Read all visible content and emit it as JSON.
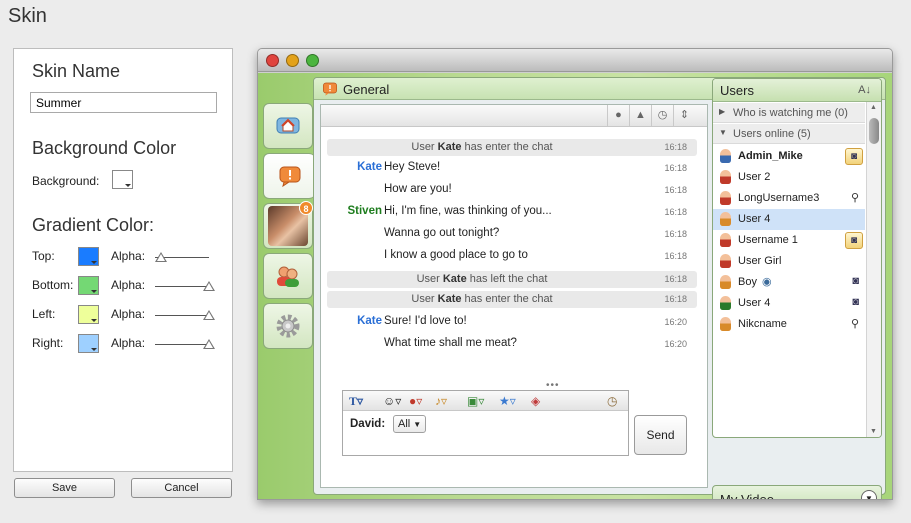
{
  "page": {
    "title": "Skin"
  },
  "skin_editor": {
    "name_label": "Skin Name",
    "name_value": "Summer",
    "background_section": "Background Color",
    "background_label": "Background:",
    "gradient_section": "Gradient Color:",
    "rows": [
      {
        "label": "Top:",
        "color": "#1a7cff",
        "alpha_label": "Alpha:",
        "alpha": 0.0
      },
      {
        "label": "Bottom:",
        "color": "#74d874",
        "alpha_label": "Alpha:",
        "alpha": 1.0
      },
      {
        "label": "Left:",
        "color": "#eeff9a",
        "alpha_label": "Alpha:",
        "alpha": 1.0
      },
      {
        "label": "Right:",
        "color": "#9ed0ff",
        "alpha_label": "Alpha:",
        "alpha": 1.0
      }
    ],
    "background_color": "#ffffff",
    "save_label": "Save",
    "cancel_label": "Cancel"
  },
  "chat": {
    "panel_title": "General",
    "messages": [
      {
        "type": "system",
        "pre": "User ",
        "name": "Kate",
        "post": " has enter the chat",
        "time": "16:18"
      },
      {
        "type": "msg",
        "sender": "Kate",
        "sender_color": "#2a6fd6",
        "text": "Hey Steve!",
        "time": "16:18"
      },
      {
        "type": "msg",
        "sender": "",
        "text": "How are you!",
        "time": "16:18"
      },
      {
        "type": "msg",
        "sender": "Stiven",
        "sender_color": "#1e7d1e",
        "text": "Hi, I'm fine, was thinking of you...",
        "time": "16:18"
      },
      {
        "type": "msg",
        "sender": "",
        "text": "Wanna go out tonight?",
        "time": "16:18"
      },
      {
        "type": "msg",
        "sender": "",
        "text": "I know a good place to go to",
        "time": "16:18"
      },
      {
        "type": "system",
        "pre": "User ",
        "name": "Kate",
        "post": " has left the chat",
        "time": "16:18"
      },
      {
        "type": "system",
        "pre": "User ",
        "name": "Kate",
        "post": " has enter the chat",
        "time": "16:18"
      },
      {
        "type": "msg",
        "sender": "Kate",
        "sender_color": "#2a6fd6",
        "text": "Sure! I'd love to!",
        "time": "16:20"
      },
      {
        "type": "msg",
        "sender": "",
        "text": "What time shall me meat?",
        "time": "16:20"
      }
    ],
    "compose_user": "David:",
    "compose_target": "All",
    "send_label": "Send",
    "grip": "•••"
  },
  "users": {
    "title": "Users",
    "sort_label": "A",
    "groups": [
      {
        "label": "Who is watching me (0)",
        "expanded": false
      },
      {
        "label": "Users online (5)",
        "expanded": true
      }
    ],
    "list": [
      {
        "name": "Admin_Mike",
        "bold": true,
        "badge": "cam-box"
      },
      {
        "name": "User 2",
        "badge": ""
      },
      {
        "name": "LongUsername3",
        "badge": "mic"
      },
      {
        "name": "User 4",
        "badge": "",
        "selected": true
      },
      {
        "name": "Username 1",
        "badge": "cam-box"
      },
      {
        "name": "User Girl",
        "badge": ""
      },
      {
        "name": "Boy",
        "badge": "cam",
        "eye": true
      },
      {
        "name": "User 4",
        "badge": "cam"
      },
      {
        "name": "Nikcname",
        "badge": "mic"
      }
    ],
    "my_video": "My Video"
  },
  "icons": {
    "traffic": [
      "#e0443e",
      "#e3a21a",
      "#4cb53f"
    ],
    "accent_green": "#9acb6c"
  }
}
